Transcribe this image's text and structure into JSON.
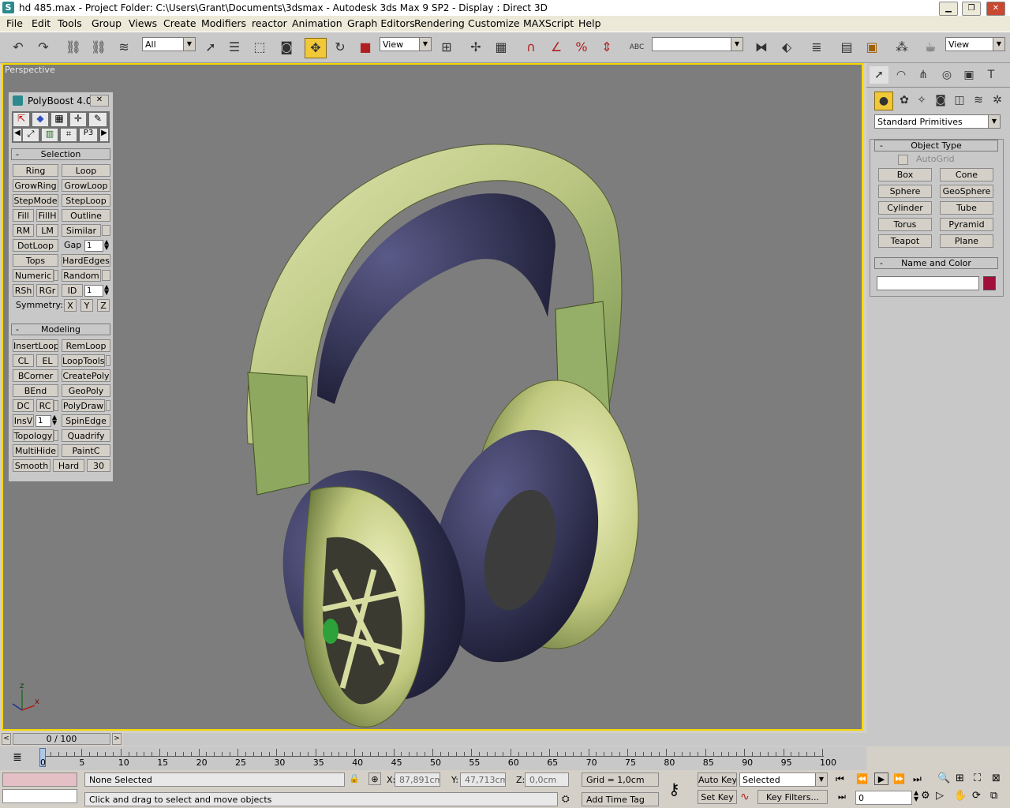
{
  "window": {
    "title": "hd 485.max    - Project Folder: C:\\Users\\Grant\\Documents\\3dsmax     - Autodesk 3ds Max 9 SP2      - Display : Direct 3D"
  },
  "menu": [
    "File",
    "Edit",
    "Tools",
    "Group",
    "Views",
    "Create",
    "Modifiers",
    "reactor",
    "Animation",
    "Graph Editors",
    "Rendering",
    "Customize",
    "MAXScript",
    "Help"
  ],
  "toolbar": {
    "selection_filter": "All",
    "ref_coord": "View",
    "named_selection": "",
    "render_view": "View",
    "abc_label": "ABC"
  },
  "viewport": {
    "label": "Perspective",
    "axis_x": "x",
    "axis_z": "z"
  },
  "polyboost": {
    "title": "PolyBoost 4.0",
    "selection_header": "Selection",
    "selection_buttons": [
      "Ring",
      "Loop",
      "GrowRing",
      "GrowLoop",
      "StepMode",
      "StepLoop",
      "Fill",
      "FillH",
      "Outline",
      "RM",
      "LM",
      "Similar",
      "DotLoop",
      "Gap",
      "1",
      "Tops",
      "HardEdges",
      "Numeric",
      "Random",
      "RSh",
      "RGr",
      "ID",
      "1",
      "Symmetry:",
      "X",
      "Y",
      "Z"
    ],
    "modeling_header": "Modeling",
    "modeling_buttons": [
      "InsertLoop",
      "RemLoop",
      "CL",
      "EL",
      "LoopTools",
      "BCorner",
      "CreatePoly",
      "BEnd",
      "GeoPoly",
      "DC",
      "RC",
      "PolyDraw",
      "InsV",
      "1",
      "SpinEdge",
      "Topology",
      "Quadrify",
      "MultiHide",
      "PaintC",
      "Smooth",
      "Hard",
      "30"
    ],
    "minus": "-"
  },
  "command_panel": {
    "category": "Standard Primitives",
    "object_type_header": "Object Type",
    "autogrid": "AutoGrid",
    "primitives": [
      "Box",
      "Cone",
      "Sphere",
      "GeoSphere",
      "Cylinder",
      "Tube",
      "Torus",
      "Pyramid",
      "Teapot",
      "Plane"
    ],
    "name_color_header": "Name and Color",
    "object_name": "",
    "object_color": "#a0103a",
    "minus": "-"
  },
  "timeline": {
    "frame_display": "0 / 100",
    "ticks": [
      "0",
      "5",
      "10",
      "15",
      "20",
      "25",
      "30",
      "35",
      "40",
      "45",
      "50",
      "55",
      "60",
      "65",
      "70",
      "75",
      "80",
      "85",
      "90",
      "95",
      "100"
    ]
  },
  "status": {
    "selection": "None Selected",
    "prompt": "Click and drag to select and move objects",
    "x_label": "X:",
    "x_value": "87,891cm",
    "y_label": "Y:",
    "y_value": "47,713cm",
    "z_label": "Z:",
    "z_value": "0,0cm",
    "grid": "Grid = 1,0cm",
    "add_time_tag": "Add Time Tag",
    "auto_key": "Auto Key",
    "set_key": "Set Key",
    "key_mode": "Selected",
    "key_filters": "Key Filters...",
    "current_frame": "0"
  },
  "colors": {
    "viewport_bg": "#7d7d7d",
    "active_border": "#f5d800",
    "headphone_body": "#c8cf8a",
    "headphone_pad": "#3a3a5e"
  }
}
